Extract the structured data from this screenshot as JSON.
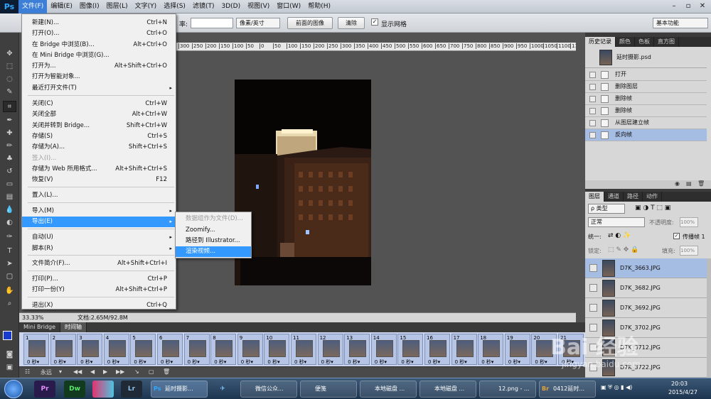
{
  "menubar": {
    "logo": "Ps",
    "items": [
      "文件(F)",
      "编辑(E)",
      "图像(I)",
      "图层(L)",
      "文字(Y)",
      "选择(S)",
      "滤镜(T)",
      "3D(D)",
      "视图(V)",
      "窗口(W)",
      "帮助(H)"
    ]
  },
  "optbar": {
    "resolution_label": "率:",
    "unit_select": "像素/英寸",
    "front_image_button": "前面的图像",
    "clear_button": "清除",
    "show_grid_label": "显示网格",
    "workspace_select": "基本功能"
  },
  "file_menu": {
    "items": [
      {
        "label": "新建(N)...",
        "shortcut": "Ctrl+N"
      },
      {
        "label": "打开(O)...",
        "shortcut": "Ctrl+O"
      },
      {
        "label": "在 Bridge 中浏览(B)...",
        "shortcut": "Alt+Ctrl+O"
      },
      {
        "label": "在 Mini Bridge 中浏览(G)...",
        "shortcut": ""
      },
      {
        "label": "打开为...",
        "shortcut": "Alt+Shift+Ctrl+O"
      },
      {
        "label": "打开为智能对象...",
        "shortcut": ""
      },
      {
        "label": "最近打开文件(T)",
        "shortcut": "",
        "arrow": "▸"
      },
      {
        "label": "关闭(C)",
        "shortcut": "Ctrl+W"
      },
      {
        "label": "关闭全部",
        "shortcut": "Alt+Ctrl+W"
      },
      {
        "label": "关闭并转到 Bridge...",
        "shortcut": "Shift+Ctrl+W"
      },
      {
        "label": "存储(S)",
        "shortcut": "Ctrl+S"
      },
      {
        "label": "存储为(A)...",
        "shortcut": "Shift+Ctrl+S"
      },
      {
        "label": "签入(I)...",
        "shortcut": ""
      },
      {
        "label": "存储为 Web 所用格式...",
        "shortcut": "Alt+Shift+Ctrl+S"
      },
      {
        "label": "恢复(V)",
        "shortcut": "F12"
      },
      {
        "label": "置入(L)...",
        "shortcut": ""
      },
      {
        "label": "导入(M)",
        "shortcut": "",
        "arrow": "▸"
      },
      {
        "label": "导出(E)",
        "shortcut": "",
        "arrow": "▸"
      },
      {
        "label": "自动(U)",
        "shortcut": "",
        "arrow": "▸"
      },
      {
        "label": "脚本(R)",
        "shortcut": "",
        "arrow": "▸"
      },
      {
        "label": "文件简介(F)...",
        "shortcut": "Alt+Shift+Ctrl+I"
      },
      {
        "label": "打印(P)...",
        "shortcut": "Ctrl+P"
      },
      {
        "label": "打印一份(Y)",
        "shortcut": "Alt+Shift+Ctrl+P"
      },
      {
        "label": "退出(X)",
        "shortcut": "Ctrl+Q"
      }
    ]
  },
  "export_submenu": {
    "items": [
      "数据组作为文件(D)...",
      "Zoomify...",
      "路径到 Illustrator...",
      "渲染视频..."
    ]
  },
  "ruler": {
    "ticks": [
      "300",
      "250",
      "200",
      "150",
      "100",
      "50",
      "0",
      "50",
      "100",
      "150",
      "200",
      "250",
      "300",
      "350",
      "400",
      "450",
      "500",
      "550",
      "600",
      "650",
      "700",
      "750",
      "800",
      "850",
      "900",
      "950",
      "1000",
      "1050",
      "1100",
      "1150",
      "1200",
      "1250",
      "1300",
      "1350",
      "1400",
      "1450",
      "1500"
    ]
  },
  "status": {
    "zoom": "33.33%",
    "doc": "文档:2.65M/92.8M"
  },
  "timeline": {
    "tabs": [
      "Mini Bridge",
      "时间轴"
    ],
    "frames": [
      {
        "num": "1",
        "delay": "0 秒▾"
      },
      {
        "num": "2",
        "delay": "0 秒▾"
      },
      {
        "num": "3",
        "delay": "0 秒▾"
      },
      {
        "num": "4",
        "delay": "0 秒▾"
      },
      {
        "num": "5",
        "delay": "0 秒▾"
      },
      {
        "num": "6",
        "delay": "0 秒▾"
      },
      {
        "num": "7",
        "delay": "0 秒▾"
      },
      {
        "num": "8",
        "delay": "0 秒▾"
      },
      {
        "num": "9",
        "delay": "0 秒▾"
      },
      {
        "num": "10",
        "delay": "0 秒▾"
      },
      {
        "num": "11",
        "delay": "0 秒▾"
      },
      {
        "num": "12",
        "delay": "0 秒▾"
      },
      {
        "num": "13",
        "delay": "0 秒▾"
      },
      {
        "num": "14",
        "delay": "0 秒▾"
      },
      {
        "num": "15",
        "delay": "0 秒▾"
      },
      {
        "num": "16",
        "delay": "0 秒▾"
      },
      {
        "num": "17",
        "delay": "0 秒▾"
      },
      {
        "num": "18",
        "delay": "0 秒▾"
      },
      {
        "num": "19",
        "delay": "0 秒▾"
      },
      {
        "num": "20",
        "delay": "0 秒▾"
      },
      {
        "num": "21",
        "delay": "0 秒▾"
      }
    ],
    "loop": "永远"
  },
  "history_panel": {
    "tabs": [
      "历史记录",
      "颜色",
      "色板",
      "直方图"
    ],
    "snapshot": "延时摄影.psd",
    "items": [
      "打开",
      "删除图层",
      "删除帧",
      "删除帧",
      "从图层建立帧",
      "反向帧"
    ]
  },
  "layers_panel": {
    "tabs": [
      "图层",
      "通道",
      "路径",
      "动作"
    ],
    "kind_select": "ρ 类型",
    "blend_mode": "正常",
    "opacity_label": "不透明度:",
    "opacity_value": "100%",
    "unify_label": "统一:",
    "propagate_label": "传播帧 1",
    "lock_label": "锁定:",
    "fill_label": "填充:",
    "fill_value": "100%",
    "layers": [
      "D7K_3663.JPG",
      "D7K_3682.JPG",
      "D7K_3692.JPG",
      "D7K_3702.JPG",
      "D7K_3712.JPG",
      "D7K_3722.JPG"
    ]
  },
  "taskbar": {
    "apps": [
      "Pr",
      "Dw",
      "",
      "Lr",
      "延时摄影...",
      "",
      "微信公众...",
      "便笺",
      "本地磁盘 ...",
      "本地磁盘 ...",
      "12.png - ...",
      "0412延时..."
    ],
    "ps_icon": "Ps",
    "br_icon": "Br",
    "time": "20:03",
    "date": "2015/4/27",
    "lang": "中"
  },
  "watermark": {
    "brand": "Bai 经验",
    "url": "jingyan.baidu.com"
  },
  "colors": {
    "menu_highlight": "#3399ff",
    "frame_bg": "#b6c5e6",
    "history_selected": "#a5bce3",
    "app_bg": "#535353"
  }
}
